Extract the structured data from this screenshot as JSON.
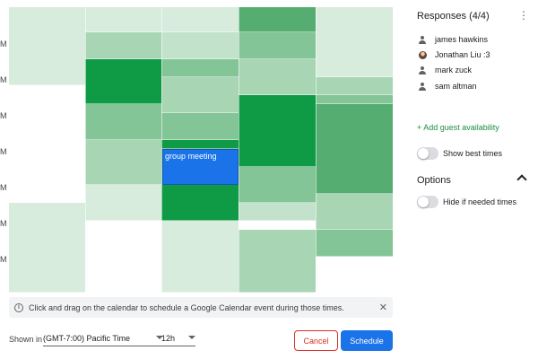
{
  "grid": {
    "time_labels": [
      "M",
      "M",
      "M",
      "M",
      "M",
      "M",
      "M"
    ],
    "colors": {
      "c0": "#ffffff",
      "c1": "#d7ecdc",
      "c2": "#c3e2cb",
      "c3": "#a8d5b4",
      "c4": "#83c597",
      "c5": "#55ad72",
      "c6": "#0f9a45"
    },
    "columns": [
      {
        "cells": [
          {
            "h": 87,
            "c": "c1"
          },
          {
            "h": 131,
            "c": "c0"
          },
          {
            "h": 100,
            "c": "c1"
          }
        ]
      },
      {
        "cells": [
          {
            "h": 28,
            "c": "c1"
          },
          {
            "h": 30,
            "c": "c3"
          },
          {
            "h": 50,
            "c": "c6"
          },
          {
            "h": 40,
            "c": "c4"
          },
          {
            "h": 50,
            "c": "c3"
          },
          {
            "h": 40,
            "c": "c1"
          },
          {
            "h": 80,
            "c": "c0"
          }
        ]
      },
      {
        "cells": [
          {
            "h": 28,
            "c": "c1"
          },
          {
            "h": 30,
            "c": "c2"
          },
          {
            "h": 20,
            "c": "c4"
          },
          {
            "h": 40,
            "c": "c3"
          },
          {
            "h": 30,
            "c": "c4"
          },
          {
            "h": 10,
            "c": "c6"
          },
          {
            "h": 40,
            "c": "c5"
          },
          {
            "h": 40,
            "c": "c6"
          },
          {
            "h": 80,
            "c": "c1"
          }
        ]
      },
      {
        "cells": [
          {
            "h": 28,
            "c": "c5"
          },
          {
            "h": 30,
            "c": "c4"
          },
          {
            "h": 40,
            "c": "c3"
          },
          {
            "h": 80,
            "c": "c6"
          },
          {
            "h": 40,
            "c": "c4"
          },
          {
            "h": 20,
            "c": "c2"
          },
          {
            "h": 10,
            "c": "c0"
          },
          {
            "h": 70,
            "c": "c3"
          }
        ]
      },
      {
        "cells": [
          {
            "h": 78,
            "c": "c1"
          },
          {
            "h": 20,
            "c": "c3"
          },
          {
            "h": 10,
            "c": "c4"
          },
          {
            "h": 100,
            "c": "c5"
          },
          {
            "h": 40,
            "c": "c3"
          },
          {
            "h": 30,
            "c": "c4"
          },
          {
            "h": 40,
            "c": "c0"
          }
        ]
      }
    ],
    "event_label": "group meeting"
  },
  "banner": {
    "info_icon": "i",
    "text": "Click and drag on the calendar to schedule a Google Calendar event during those times.",
    "close_icon": "✕"
  },
  "footer": {
    "shown_in_label": "Shown in",
    "timezone": "(GMT-7:00) Pacific Time",
    "format": "12h",
    "cancel_label": "Cancel",
    "schedule_label": "Schedule"
  },
  "panel": {
    "responses_title": "Responses (4/4)",
    "kebab_icon": "⋮",
    "people": [
      {
        "name": "james hawkins",
        "avatar": "person-icon"
      },
      {
        "name": "Jonathan Liu :3",
        "avatar": "photo"
      },
      {
        "name": "mark zuck",
        "avatar": "person-icon"
      },
      {
        "name": "sam altman",
        "avatar": "person-icon"
      }
    ],
    "add_guest": "+ Add guest availability",
    "show_best_times": "Show best times",
    "options_title": "Options",
    "hide_if_needed": "Hide if needed times"
  }
}
